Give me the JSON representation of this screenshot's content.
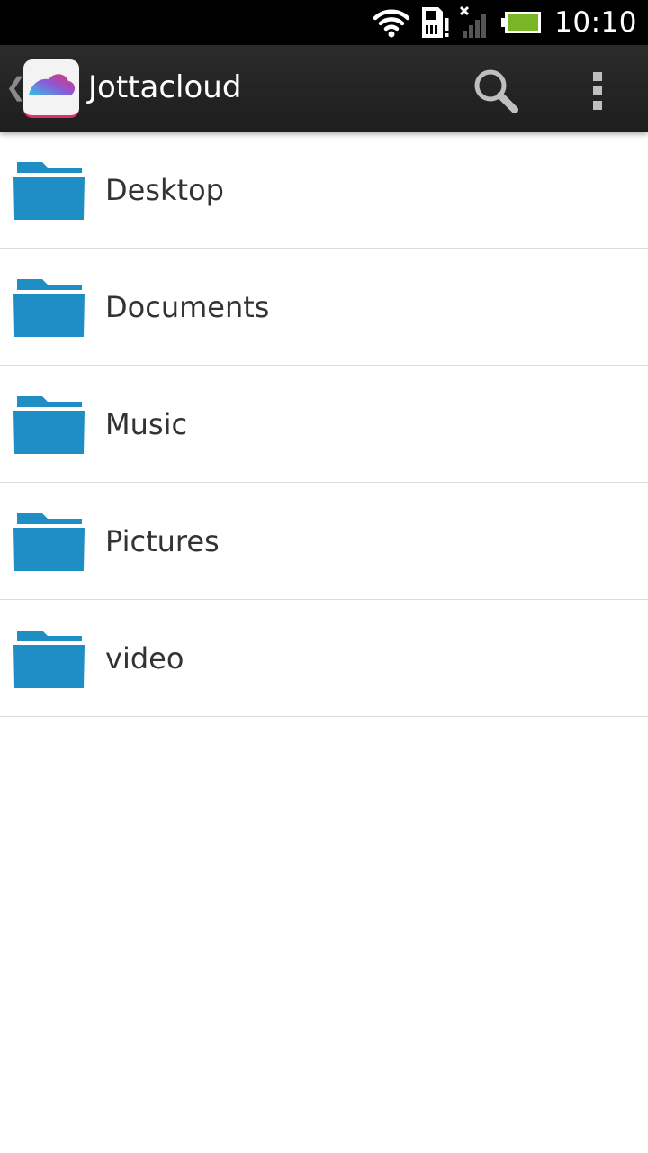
{
  "status_bar": {
    "time": "10:10",
    "icons": [
      "wifi-icon",
      "sd-card-icon",
      "signal-off-icon",
      "battery-icon"
    ],
    "battery_color": "#7ab526"
  },
  "action_bar": {
    "app_name": "Jottacloud",
    "icons": [
      "up-caret-icon",
      "jottacloud-logo",
      "search-icon",
      "overflow-menu-icon"
    ]
  },
  "folders": [
    {
      "label": "Desktop"
    },
    {
      "label": "Documents"
    },
    {
      "label": "Music"
    },
    {
      "label": "Pictures"
    },
    {
      "label": "video"
    }
  ],
  "colors": {
    "folder": "#1f8ec4",
    "action_bar": "#222222",
    "text": "#333333"
  }
}
